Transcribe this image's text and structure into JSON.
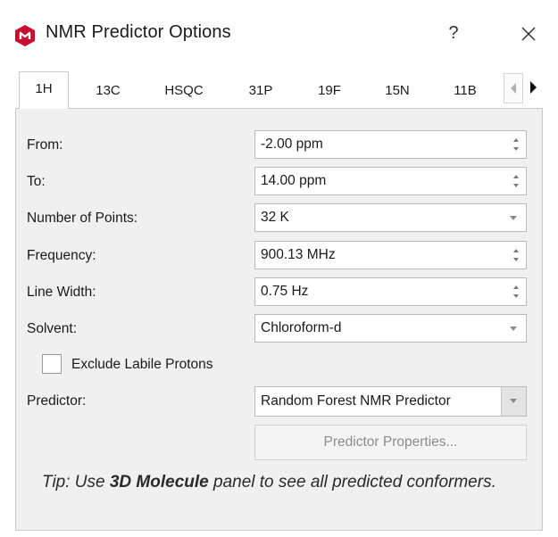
{
  "window": {
    "title": "NMR Predictor Options",
    "help_label": "?",
    "icon": "app-logo-icon",
    "brand_color": "#c8102e"
  },
  "tabs": [
    {
      "label": "1H",
      "active": true
    },
    {
      "label": "13C",
      "active": false
    },
    {
      "label": "HSQC",
      "active": false
    },
    {
      "label": "31P",
      "active": false
    },
    {
      "label": "19F",
      "active": false
    },
    {
      "label": "15N",
      "active": false
    },
    {
      "label": "11B",
      "active": false
    }
  ],
  "form": {
    "from": {
      "label": "From:",
      "value": "-2.00 ppm"
    },
    "to": {
      "label": "To:",
      "value": "14.00 ppm"
    },
    "points": {
      "label": "Number of Points:",
      "value": "32 K"
    },
    "frequency": {
      "label": "Frequency:",
      "value": "900.13 MHz"
    },
    "line_width": {
      "label": "Line Width:",
      "value": "0.75 Hz"
    },
    "solvent": {
      "label": "Solvent:",
      "value": "Chloroform-d"
    },
    "exclude_labile": {
      "label": "Exclude Labile Protons",
      "checked": false
    },
    "predictor": {
      "label": "Predictor:",
      "value": "Random Forest NMR Predictor"
    },
    "predictor_properties_label": "Predictor Properties..."
  },
  "tip": {
    "prefix": "Tip: Use ",
    "bold": "3D Molecule",
    "suffix": " panel to see all predicted conformers."
  }
}
